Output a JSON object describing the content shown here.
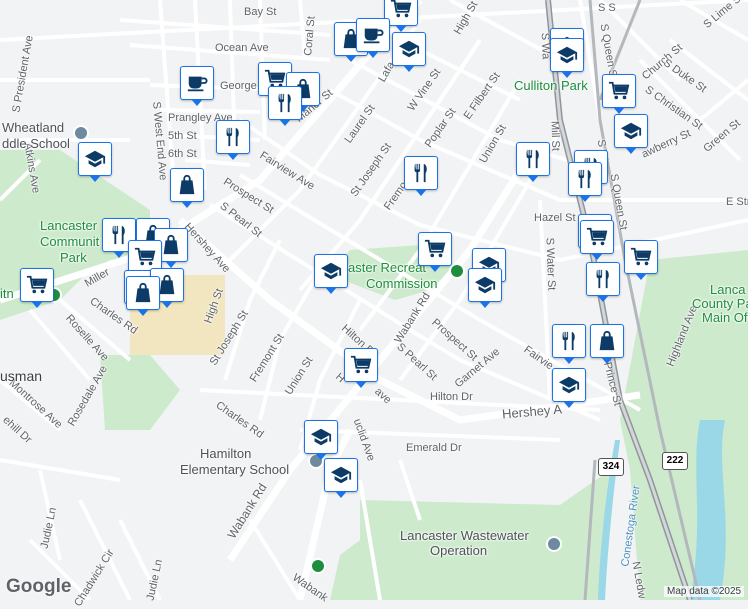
{
  "streets": {
    "bay_st": "Bay St",
    "ocean_ave": "Ocean Ave",
    "coral_st": "Coral St",
    "s_president_ave": "S President Ave",
    "s_west_end_ave": "S West End Ave",
    "george_st": "George",
    "prangley_ave": "Prangley Ave",
    "fifth_st": "5th St",
    "sixth_st": "6th St",
    "atkins_ave": "Atkins Ave",
    "manor_st": "Manor St",
    "high_st_top": "High St",
    "w_vine_st": "W Vine St",
    "e_filbert_st": "E Filbert St",
    "laurel_st": "Laurel St",
    "poplar_st": "Poplar St",
    "union_st_top": "Union St",
    "st_joseph_st_top": "St Joseph St",
    "fairview_ave_top": "Fairview Ave",
    "prospect_st_top": "Prospect St",
    "fremont_st_top": "Fremo",
    "s_pearl_st_top": "S Pearl St",
    "hershey_ave_left": "Hershey Ave",
    "high_st_left": "High St",
    "miller_st": "Miller",
    "charles_rd_left": "Charles Rd",
    "roselle_ave": "Roselle Ave",
    "rosedale_ave": "Rosedale Ave",
    "montrose_ave": "Montrose Ave",
    "hill_dr_edge": "ehill Dr",
    "st_joseph_st_mid": "St Joseph St",
    "fremont_st_mid": "Fremont St",
    "union_st_mid": "Union St",
    "charles_rd_mid": "Charles Rd",
    "hilton_dr_mid": "Hilton D",
    "hershey_ave_mid": "H",
    "hershey_ave_mid2": "ave",
    "wabank_rd_mid": "Wabank Rd",
    "s_pearl_st_mid": "S Pearl St",
    "prospect_st_mid": "Prospect St",
    "garnet_ave": "Garnet Ave",
    "hilton_dr_right": "Hilton Dr",
    "hershey_ave_right": "Hershey A",
    "emerald_dr": "Emerald Dr",
    "euclid_ave": "uclid Ave",
    "wabank_rd_bottom": "Wabank Rd",
    "judie_ln_left": "Judie Ln",
    "judie_ln_bottom": "Judie Ln",
    "chadwick_cir": "Chadwick Cir",
    "wabank_bottom": "Wabank",
    "mill_st": "Mill St",
    "s_water_st": "S Water St",
    "s_water_top": "S Wa",
    "hazel_st": "Hazel St",
    "s_queen_st_top": "S Queen St",
    "s_queen_st": "S Queen St",
    "s_prince_st": "Prince St",
    "church_st": "Church St",
    "s_duke_st": "S Duke St",
    "s_christian_st": "S Christian St",
    "strawberry_st": "awberry St",
    "green_st": "Green St",
    "s_lime_st": "S Lime S",
    "e_str": "E Str",
    "highland_ave": "Highland Ave",
    "fairview_right": "Fairvie",
    "n_ledw": "N Ledw",
    "lafa": "Lafa",
    "s_w": "S W",
    "s_s": "S S",
    "conestoga_river": "Conestoga River"
  },
  "places": {
    "wheatland_school": [
      "Wheatland",
      "ddle School"
    ],
    "lancaster_community_park": [
      "Lancaster",
      "Communit",
      "Park"
    ],
    "culliton_park": "Culliton Park",
    "lancaster_recreation": [
      "aster Recreat",
      "Commission"
    ],
    "lancaster_county_park": [
      "Lanca",
      "County Pa",
      "Main Of"
    ],
    "hamilton_school": [
      "Hamilton",
      "Elementary School"
    ],
    "wastewater": [
      "Lancaster Wastewater",
      "Operation"
    ],
    "itn": "itn",
    "usman": "usman"
  },
  "route_shields": {
    "a": "324",
    "b": "222"
  },
  "pins": [
    {
      "icon": "school-icon",
      "kind": "school"
    },
    {
      "icon": "shopping-bag-icon",
      "kind": "shopping"
    },
    {
      "icon": "cafe-icon",
      "kind": "cafe"
    },
    {
      "icon": "shopping-cart-icon",
      "kind": "grocery"
    },
    {
      "icon": "restaurant-icon",
      "kind": "restaurant"
    }
  ],
  "colors": {
    "pin_border": "#1a73e8",
    "pin_icon": "#0b3b66",
    "park": "#c8e6c9",
    "water": "#9ad8e8",
    "sandy": "#f3e2b8",
    "highway": "#9aa0a6"
  },
  "branding": {
    "logo": "Google",
    "credit": "Map data ©2025"
  }
}
